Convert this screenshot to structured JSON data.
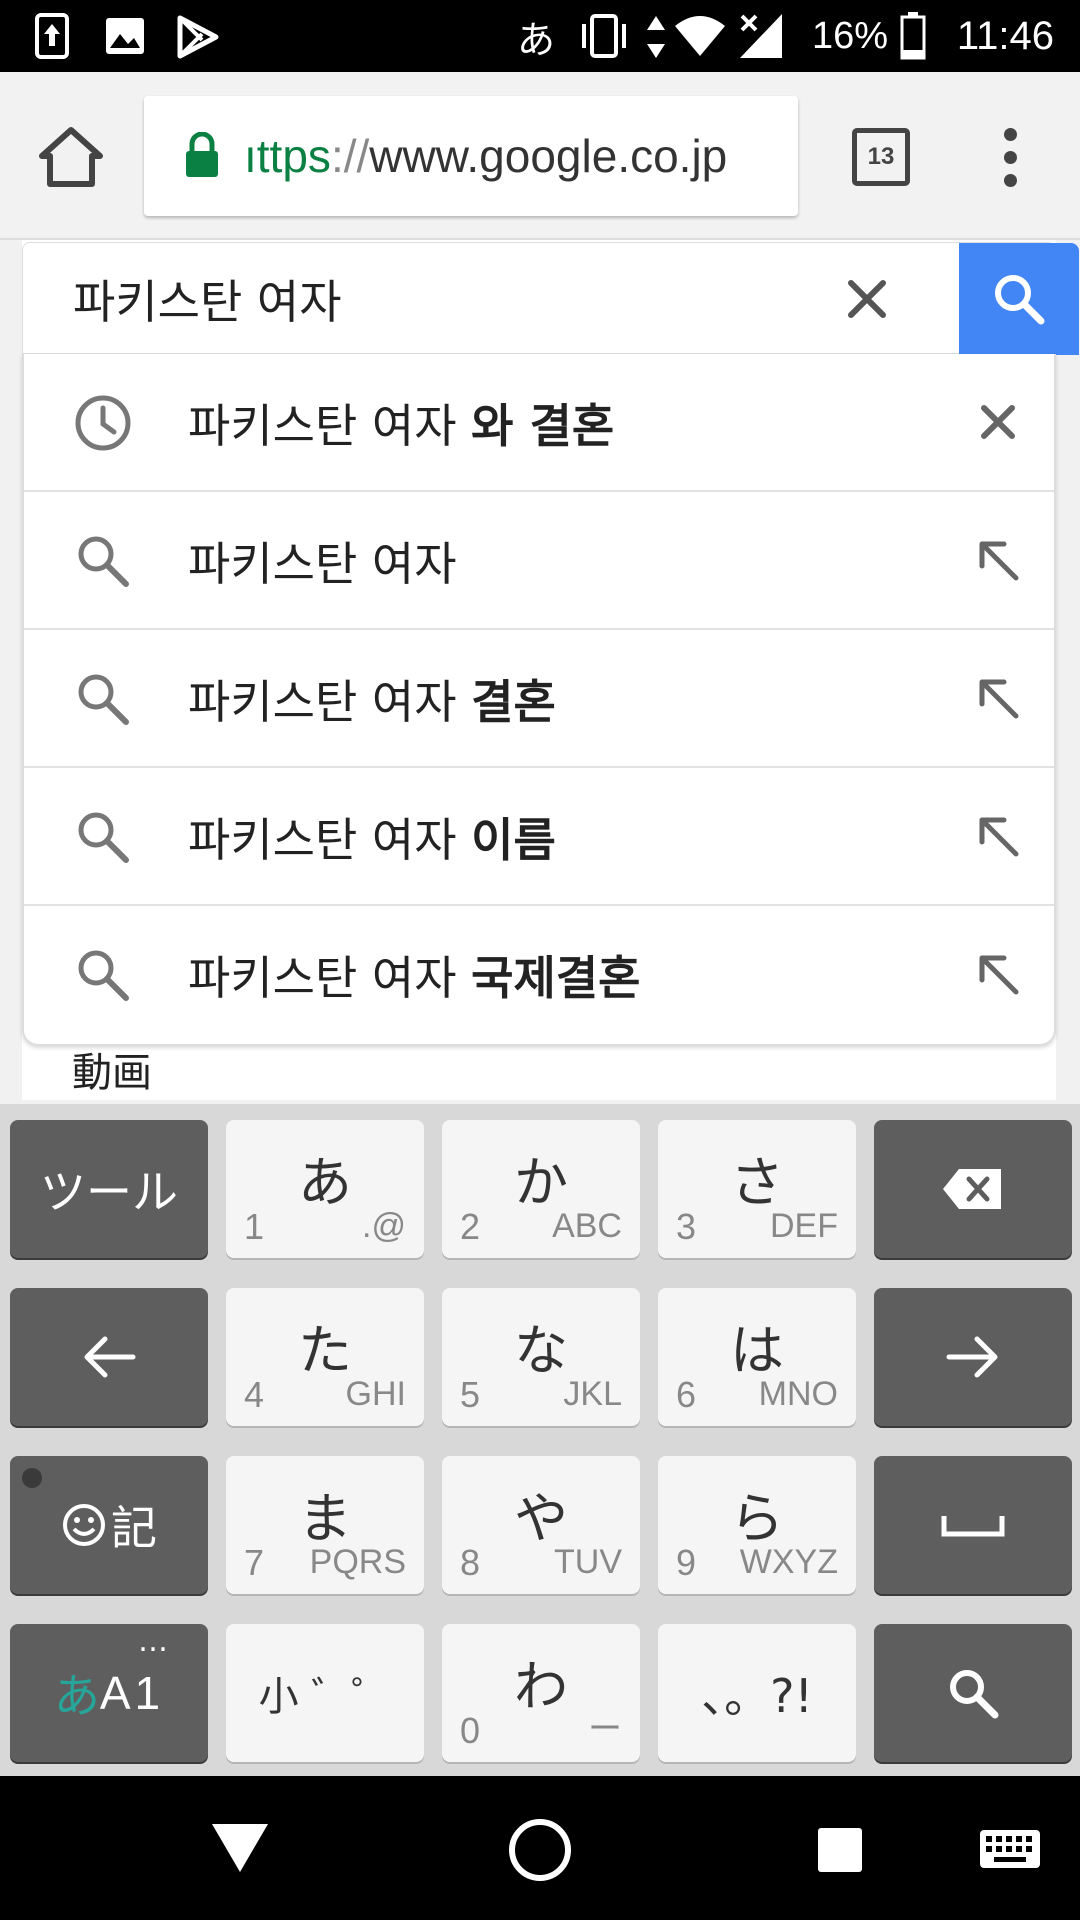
{
  "status_bar": {
    "ime_indicator": "あ",
    "battery_percent": "16%",
    "time": "11:46"
  },
  "browser": {
    "url_scheme": "ıttps",
    "url_sep": "://",
    "url_host": "www.google.co.jp",
    "tab_count": "13"
  },
  "search": {
    "query": "파키스탄 여자"
  },
  "suggestions": [
    {
      "type": "history",
      "prefix": "파키스탄 여자 ",
      "bold": "와 결혼",
      "action": "remove"
    },
    {
      "type": "search",
      "prefix": "파키스탄 여자",
      "bold": "",
      "action": "fill"
    },
    {
      "type": "search",
      "prefix": "파키스탄 여자 ",
      "bold": "결혼",
      "action": "fill"
    },
    {
      "type": "search",
      "prefix": "파키스탄 여자 ",
      "bold": "이름",
      "action": "fill"
    },
    {
      "type": "search",
      "prefix": "파키스탄 여자 ",
      "bold": "국제결혼",
      "action": "fill"
    }
  ],
  "page": {
    "videos_label": "動画"
  },
  "keyboard": {
    "tool_label": "ツール",
    "emoji_label": "記",
    "mode_label_kana": "あ",
    "mode_label_alpha": "A1",
    "mode_dots": "…",
    "keys": [
      {
        "main": "あ",
        "num": "1",
        "sub": ".@"
      },
      {
        "main": "か",
        "num": "2",
        "sub": "ABC"
      },
      {
        "main": "さ",
        "num": "3",
        "sub": "DEF"
      },
      {
        "main": "た",
        "num": "4",
        "sub": "GHI"
      },
      {
        "main": "な",
        "num": "5",
        "sub": "JKL"
      },
      {
        "main": "は",
        "num": "6",
        "sub": "MNO"
      },
      {
        "main": "ま",
        "num": "7",
        "sub": "PQRS"
      },
      {
        "main": "や",
        "num": "8",
        "sub": "TUV"
      },
      {
        "main": "ら",
        "num": "9",
        "sub": "WXYZ"
      }
    ],
    "small_key": "小 ゛゜",
    "wa_key": {
      "main": "わ",
      "num": "0",
      "sub": "ー"
    },
    "punct_key": "、。?!"
  },
  "icons": {
    "status_left": [
      "sim-toolkit-icon",
      "gallery-icon",
      "play-store-icon"
    ],
    "status_right": [
      "vibrate-icon",
      "data-icon",
      "wifi-icon",
      "signal-icon",
      "battery-icon"
    ]
  }
}
